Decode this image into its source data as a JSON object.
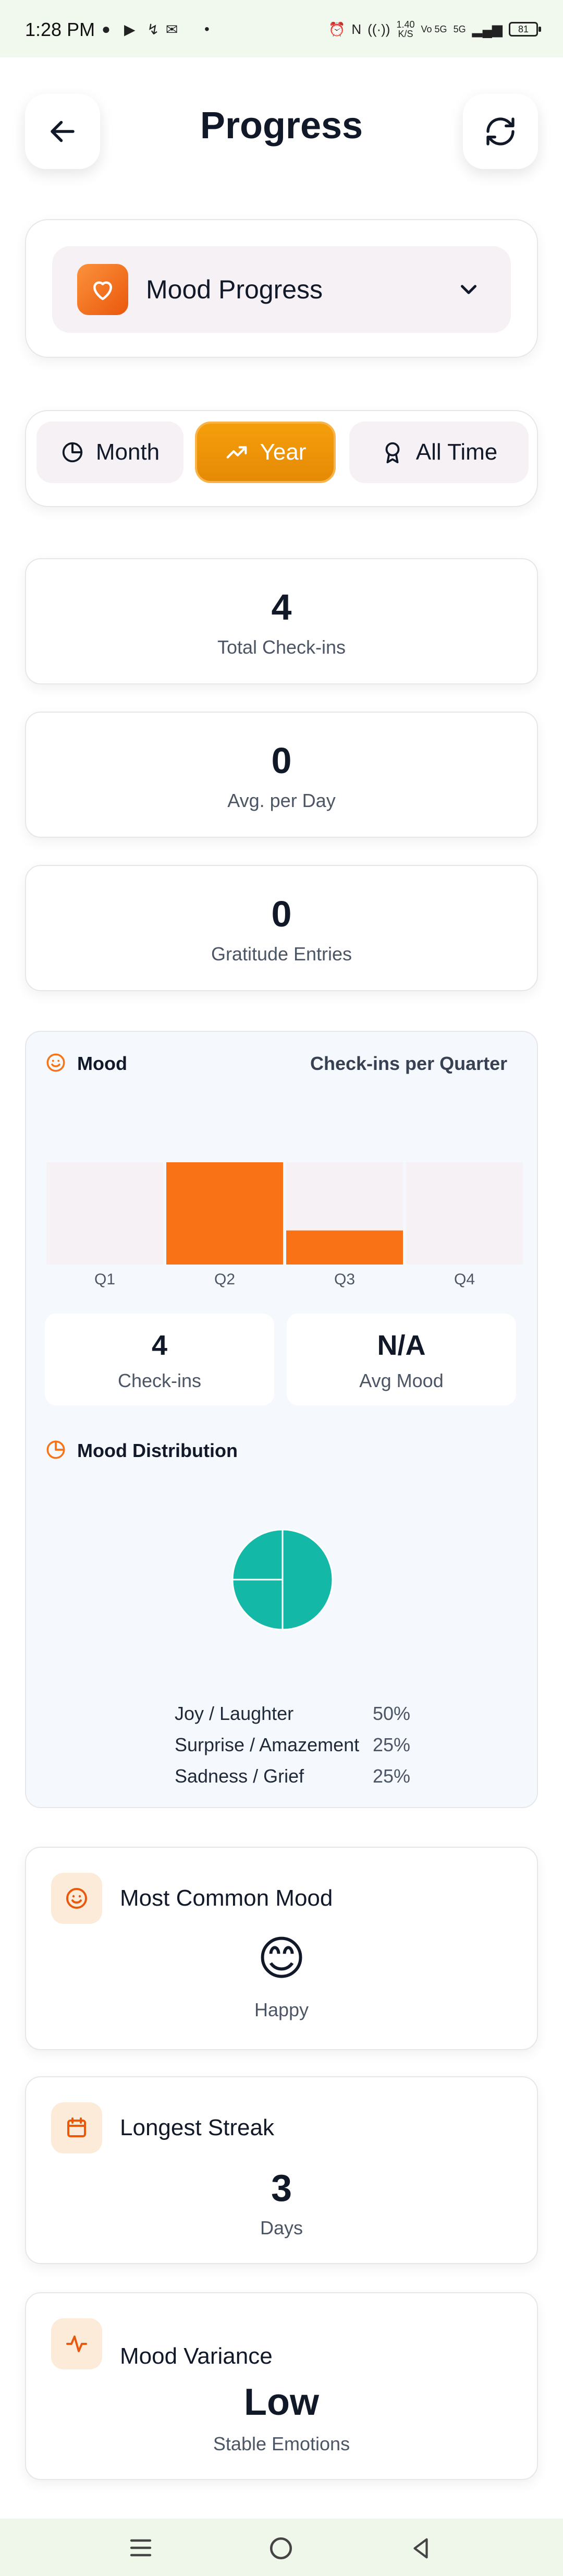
{
  "status_bar": {
    "time": "1:28 PM",
    "speed": "1.40",
    "speed_unit": "K/S",
    "network": "Vo 5G",
    "network2": "5G",
    "battery": "81"
  },
  "header": {
    "title": "Progress"
  },
  "selector": {
    "label": "Mood Progress"
  },
  "tabs": [
    {
      "label": "Month",
      "active": false
    },
    {
      "label": "Year",
      "active": true
    },
    {
      "label": "All Time",
      "active": false
    }
  ],
  "stats": [
    {
      "value": "4",
      "label": "Total Check-ins"
    },
    {
      "value": "0",
      "label": "Avg. per Day"
    },
    {
      "value": "0",
      "label": "Gratitude Entries"
    }
  ],
  "mood_panel": {
    "title": "Mood",
    "subtitle": "Check-ins per Quarter",
    "summary": [
      {
        "value": "4",
        "label": "Check-ins"
      },
      {
        "value": "N/A",
        "label": "Avg Mood"
      }
    ],
    "distribution_title": "Mood Distribution",
    "distribution": [
      {
        "label": "Joy / Laughter",
        "pct": "50%"
      },
      {
        "label": "Surprise / Amazement",
        "pct": "25%"
      },
      {
        "label": "Sadness / Grief",
        "pct": "25%"
      }
    ]
  },
  "chart_data": [
    {
      "type": "bar",
      "categories": [
        "Q1",
        "Q2",
        "Q3",
        "Q4"
      ],
      "values": [
        0,
        3,
        1,
        0
      ],
      "ylim": [
        0,
        3
      ],
      "colors": {
        "bar": "#f97316",
        "track": "#f6f1f4"
      }
    },
    {
      "type": "pie",
      "labels": [
        "Joy / Laughter",
        "Surprise / Amazement",
        "Sadness / Grief"
      ],
      "values": [
        50,
        25,
        25
      ],
      "colors": {
        "slice": "#14b8a6",
        "divider": "#ffffff"
      }
    }
  ],
  "insights": [
    {
      "title": "Most Common Mood",
      "emoji": "😊",
      "value": "",
      "sub": "Happy",
      "icon": "smile-icon"
    },
    {
      "title": "Longest Streak",
      "emoji": "",
      "value": "3",
      "sub": "Days",
      "icon": "calendar-icon"
    },
    {
      "title": "Mood Variance",
      "emoji": "",
      "value": "Low",
      "sub": "Stable Emotions",
      "icon": "activity-icon"
    }
  ],
  "colors": {
    "accent": "#f97316",
    "tab_active": "#f59e0b",
    "teal": "#14b8a6"
  }
}
